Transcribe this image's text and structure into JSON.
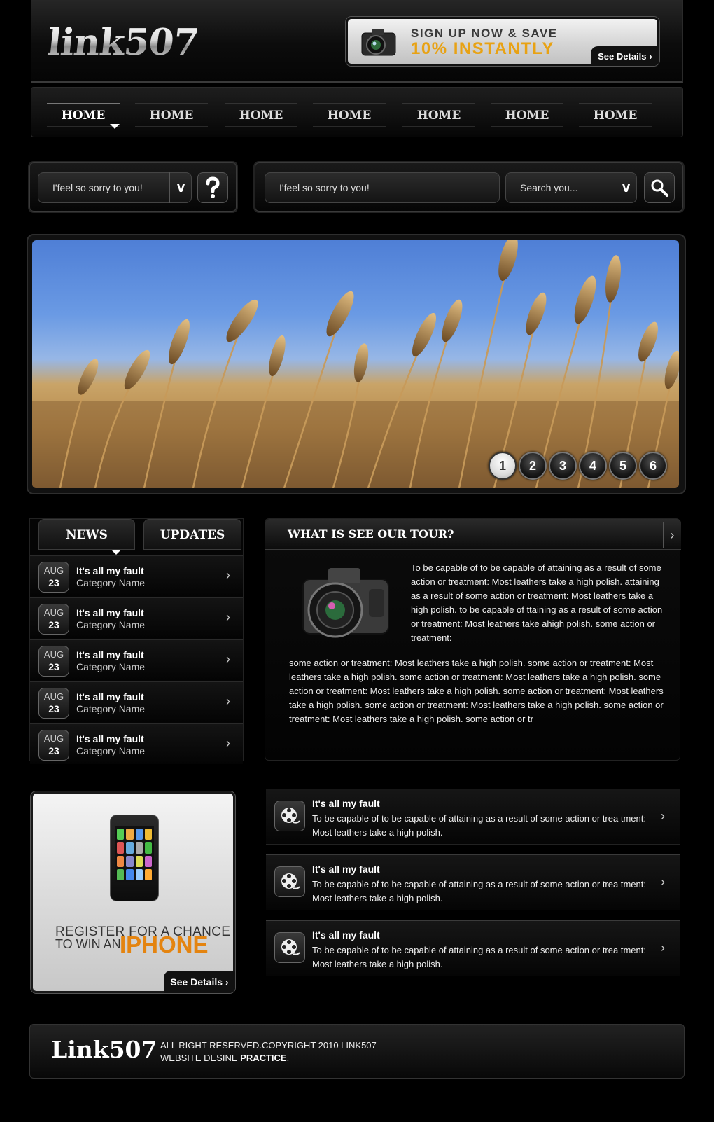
{
  "header": {
    "logo": "link507",
    "promo": {
      "line1": "SIGN UP NOW & SAVE",
      "line2": "10% INSTANTLY",
      "button": "See Details"
    }
  },
  "nav": {
    "items": [
      "HOME",
      "HOME",
      "HOME",
      "HOME",
      "HOME",
      "HOME",
      "HOME"
    ],
    "active_index": 0
  },
  "search_small": {
    "value": "I'feel so sorry to you!",
    "dropdown_label": "v",
    "help_icon": "question-icon"
  },
  "search_main": {
    "value": "I'feel so sorry to you!",
    "scope_value": "Search you...",
    "dropdown_label": "v",
    "search_icon": "magnifier-icon"
  },
  "slider": {
    "pages": [
      "1",
      "2",
      "3",
      "4",
      "5",
      "6"
    ],
    "active_page": "1"
  },
  "news": {
    "tabs": [
      "NEWS",
      "UPDATES"
    ],
    "active_tab": "NEWS",
    "items": [
      {
        "month": "AUG",
        "day": "23",
        "title": "It's all my fault",
        "category": "Category Name"
      },
      {
        "month": "AUG",
        "day": "23",
        "title": "It's all my fault",
        "category": "Category Name"
      },
      {
        "month": "AUG",
        "day": "23",
        "title": "It's all my fault",
        "category": "Category Name"
      },
      {
        "month": "AUG",
        "day": "23",
        "title": "It's all my fault",
        "category": "Category Name"
      },
      {
        "month": "AUG",
        "day": "23",
        "title": "It's all my fault",
        "category": "Category Name"
      }
    ]
  },
  "tour": {
    "title": "WHAT IS SEE OUR TOUR?",
    "para1": "To be capable of to be capable of attaining as a result of some action or treatment: Most leathers take a high polish. attaining as a result of some action or treatment: Most leathers take a high polish. to be capable of ttaining as a result of some action or treatment: Most leathers take ahigh polish. some action or treatment:",
    "para2": "some action or treatment: Most leathers take a high polish. some action or treatment: Most leathers take a high polish. some action or treatment: Most leathers take a high polish. some action or treatment: Most leathers take a high polish. some action or treatment: Most leathers take a high polish. some action or treatment: Most leathers take a high polish. some action or treatment: Most leathers take a high polish. some action or tr"
  },
  "phone_promo": {
    "line1": "REGISTER FOR A CHANCE",
    "line2": "TO WIN AN",
    "highlight": "IPHONE",
    "button": "See Details"
  },
  "features": [
    {
      "title": "It's all my fault",
      "text": "To be capable of to be capable of attaining as a result of some action or trea tment: Most leathers take a high polish."
    },
    {
      "title": "It's all my fault",
      "text": "To be capable of to be capable of attaining as a result of some action or trea tment: Most leathers take a high polish."
    },
    {
      "title": "It's all my fault",
      "text": "To be capable of to be capable of attaining as a result of some action or trea tment: Most leathers take a high polish."
    }
  ],
  "footer": {
    "logo": "Link507",
    "line1": "ALL RIGHT RESERVED.COPYRIGHT 2010 LINK507",
    "line2_prefix": "WEBSITE DESINE",
    "line2_bold": "PRACTICE",
    "line2_suffix": "."
  },
  "colors": {
    "accent_orange": "#e8a214",
    "iphone_orange": "#e48410",
    "background": "#000000"
  }
}
